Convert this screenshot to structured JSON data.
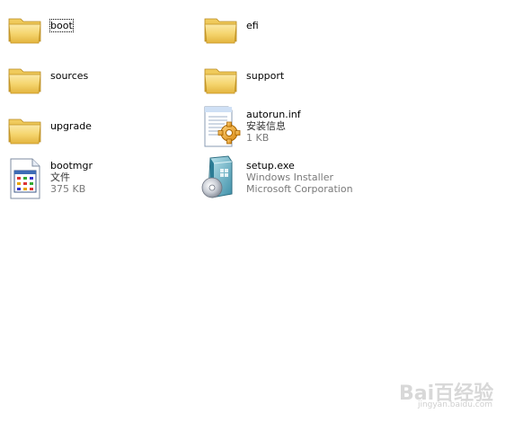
{
  "items": [
    {
      "name": "boot",
      "icon": "folder-icon"
    },
    {
      "name": "efi",
      "icon": "folder-icon"
    },
    {
      "name": "sources",
      "icon": "folder-icon"
    },
    {
      "name": "support",
      "icon": "folder-icon"
    },
    {
      "name": "upgrade",
      "icon": "folder-icon"
    },
    {
      "name": "autorun.inf",
      "type": "安装信息",
      "size": "1 KB",
      "icon": "setup-info-file-icon"
    },
    {
      "name": "bootmgr",
      "type": "文件",
      "size": "375 KB",
      "icon": "generic-file-icon"
    },
    {
      "name": "setup.exe",
      "type": "Windows Installer",
      "company": "Microsoft Corporation",
      "icon": "installer-icon"
    }
  ],
  "watermark": {
    "text": "Bai百经验",
    "sub": "jingyan.baidu.com"
  },
  "colors": {
    "folder_body": "#f5d56f",
    "folder_dark": "#d9a92e",
    "sub_text": "#7a7a7a",
    "background": "#ffffff"
  }
}
